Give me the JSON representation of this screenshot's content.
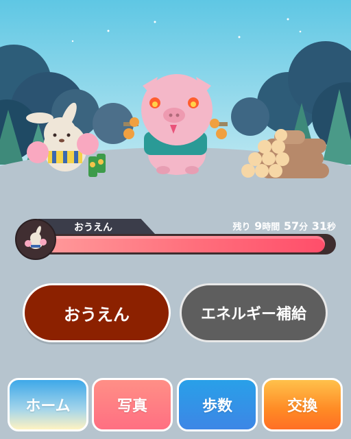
{
  "status": {
    "label": "おうえん",
    "remaining_prefix": "残り",
    "hours": "9",
    "hours_unit": "時間",
    "minutes": "57",
    "minutes_unit": "分",
    "seconds": "31",
    "seconds_unit": "秒",
    "progress_fraction": 0.97
  },
  "actions": {
    "cheer_label": "おうえん",
    "energy_label": "エネルギー補給"
  },
  "nav": {
    "home": "ホーム",
    "photo": "写真",
    "steps": "歩数",
    "exchange": "交換"
  },
  "colors": {
    "cheer_button": "#8c2100",
    "energy_button": "#5e5e5e",
    "progress": "#ff5a73"
  }
}
